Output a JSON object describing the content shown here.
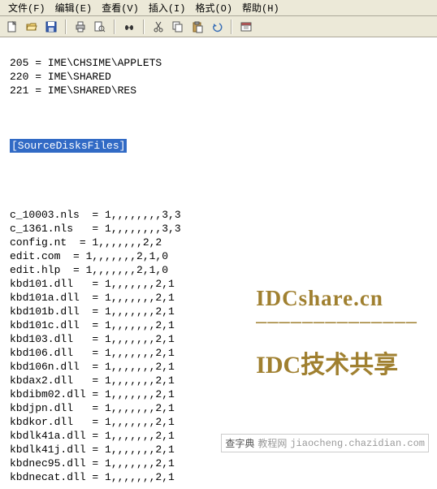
{
  "menubar": {
    "items": [
      {
        "label": "文件(F)"
      },
      {
        "label": "编辑(E)"
      },
      {
        "label": "查看(V)"
      },
      {
        "label": "插入(I)"
      },
      {
        "label": "格式(O)"
      },
      {
        "label": "帮助(H)"
      }
    ]
  },
  "toolbar": {
    "icons": [
      {
        "name": "new-icon"
      },
      {
        "name": "open-icon"
      },
      {
        "name": "save-icon"
      },
      {
        "sep": true
      },
      {
        "name": "print-icon"
      },
      {
        "name": "print-preview-icon"
      },
      {
        "sep": true
      },
      {
        "name": "find-icon"
      },
      {
        "sep": true
      },
      {
        "name": "cut-icon"
      },
      {
        "name": "copy-icon"
      },
      {
        "name": "paste-icon"
      },
      {
        "name": "undo-icon"
      },
      {
        "sep": true
      },
      {
        "name": "date-icon"
      }
    ]
  },
  "content": {
    "top_lines": [
      "205 = IME\\CHSIME\\APPLETS",
      "220 = IME\\SHARED",
      "221 = IME\\SHARED\\RES"
    ],
    "section_header": "[SourceDisksFiles]",
    "file_lines": [
      "c_10003.nls  = 1,,,,,,,,3,3",
      "c_1361.nls   = 1,,,,,,,,3,3",
      "config.nt  = 1,,,,,,,2,2",
      "edit.com  = 1,,,,,,,2,1,0",
      "edit.hlp  = 1,,,,,,,2,1,0",
      "kbd101.dll   = 1,,,,,,,2,1",
      "kbd101a.dll  = 1,,,,,,,2,1",
      "kbd101b.dll  = 1,,,,,,,2,1",
      "kbd101c.dll  = 1,,,,,,,2,1",
      "kbd103.dll   = 1,,,,,,,2,1",
      "kbd106.dll   = 1,,,,,,,2,1",
      "kbd106n.dll  = 1,,,,,,,2,1",
      "kbdax2.dll   = 1,,,,,,,2,1",
      "kbdibm02.dll = 1,,,,,,,2,1",
      "kbdjpn.dll   = 1,,,,,,,2,1",
      "kbdkor.dll   = 1,,,,,,,2,1",
      "kbdlk41a.dll = 1,,,,,,,2,1",
      "kbdlk41j.dll = 1,,,,,,,2,1",
      "kbdnec95.dll = 1,,,,,,,2,1",
      "kbdnecat.dll = 1,,,,,,,2,1"
    ]
  },
  "watermark": {
    "url": "IDCshare.cn",
    "divider": "——————————————",
    "slogan": "IDC技术共享"
  },
  "footer": {
    "site1": "查字典",
    "site2": "教程网",
    "domain": "jiaocheng.chazidian.com"
  }
}
